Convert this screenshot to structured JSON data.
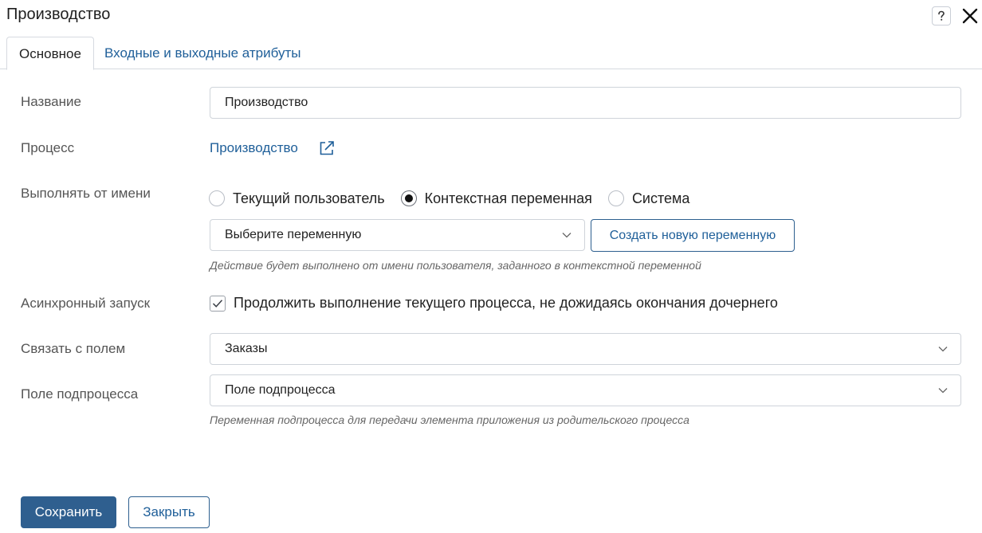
{
  "window": {
    "title": "Производство",
    "help_icon": "question-mark-icon",
    "close_icon": "close-x-icon"
  },
  "tabs": [
    {
      "label": "Основное",
      "active": true
    },
    {
      "label": "Входные и выходные атрибуты",
      "active": false
    }
  ],
  "form": {
    "name": {
      "label": "Название",
      "value": "Производство"
    },
    "process": {
      "label": "Процесс",
      "link_text": "Производство",
      "icon": "external-link-icon"
    },
    "run_as": {
      "label": "Выполнять от имени",
      "options": [
        {
          "label": "Текущий пользователь",
          "checked": false
        },
        {
          "label": "Контекстная переменная",
          "checked": true
        },
        {
          "label": "Система",
          "checked": false
        }
      ],
      "select_value": "Выберите переменную",
      "create_button": "Создать новую переменную",
      "hint": "Действие будет выполнено от имени пользователя, заданного в контекстной переменной"
    },
    "async": {
      "label": "Асинхронный запуск",
      "checked": true,
      "checkbox_label": "Продолжить выполнение текущего процесса, не дожидаясь окончания дочернего"
    },
    "link_field": {
      "label": "Связать с полем",
      "value": "Заказы"
    },
    "subprocess_field": {
      "label": "Поле подпроцесса",
      "value": "Поле подпроцесса",
      "hint": "Переменная подпроцесса для передачи элемента приложения из родительского процесса"
    }
  },
  "footer": {
    "save_label": "Сохранить",
    "close_label": "Закрыть"
  },
  "colors": {
    "accent": "#2f5f8f",
    "link": "#1f5f99",
    "border": "#cfd4da"
  }
}
